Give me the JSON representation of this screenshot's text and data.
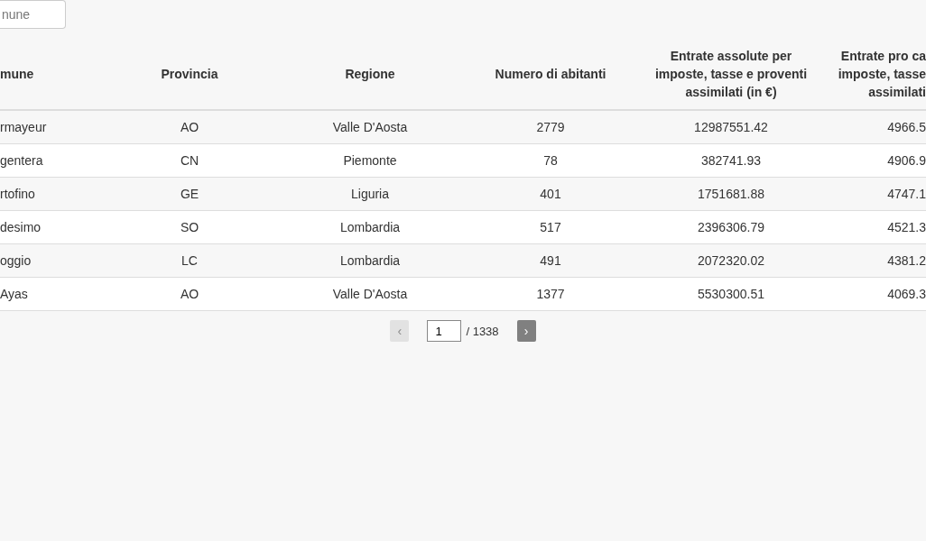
{
  "search": {
    "placeholder": "nune"
  },
  "table": {
    "columns": [
      "mune",
      "Provincia",
      "Regione",
      "Numero di abitanti",
      "Entrate assolute per\nimposte, tasse e proventi\nassimilati (in €)",
      "Entrate pro ca\nimposte, tasse\nassimilati"
    ],
    "rows": [
      [
        "rmayeur",
        "AO",
        "Valle D'Aosta",
        "2779",
        "12987551.42",
        "4966.5"
      ],
      [
        "gentera",
        "CN",
        "Piemonte",
        "78",
        "382741.93",
        "4906.9"
      ],
      [
        "rtofino",
        "GE",
        "Liguria",
        "401",
        "1751681.88",
        "4747.1"
      ],
      [
        "desimo",
        "SO",
        "Lombardia",
        "517",
        "2396306.79",
        "4521.3"
      ],
      [
        "oggio",
        "LC",
        "Lombardia",
        "491",
        "2072320.02",
        "4381.2"
      ],
      [
        "Ayas",
        "AO",
        "Valle D'Aosta",
        "1377",
        "5530300.51",
        "4069.3"
      ]
    ]
  },
  "pagination": {
    "prev": {
      "label": "‹",
      "disabled": true
    },
    "page": "1",
    "total": "/ 1338",
    "next": {
      "label": "›",
      "disabled": false
    }
  }
}
